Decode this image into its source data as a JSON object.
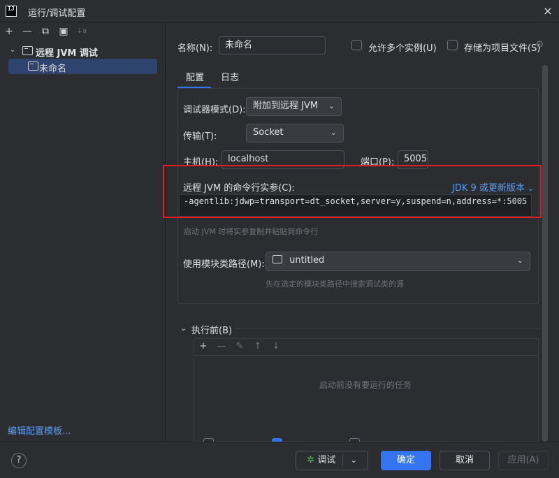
{
  "window": {
    "title": "运行/调试配置",
    "close_icon": "×"
  },
  "left_toolbar": {
    "add": "+",
    "remove": "—",
    "copy": "⧉",
    "folder": "▣",
    "sort": "↓a"
  },
  "tree": {
    "root_label": "远程 JVM 调试",
    "child_label": "未命名"
  },
  "edit_templates_link": "编辑配置模板...",
  "form": {
    "name_label": "名称(N):",
    "name_value": "未命名",
    "allow_multiple": "允许多个实例(U)",
    "store_as_project": "存储为项目文件(S)",
    "tabs": [
      "配置",
      "日志"
    ],
    "debugger_mode_label": "调试器模式(D):",
    "debugger_mode_value": "附加到远程 JVM",
    "transport_label": "传输(T):",
    "transport_value": "Socket",
    "host_label": "主机(H):",
    "host_value": "localhost",
    "port_label": "端口(P):",
    "port_value": "5005",
    "cmdline_label": "远程 JVM 的命令行实参(C):",
    "jdk_version": "JDK 9 或更新版本",
    "cmdline_value": "-agentlib:jdwp=transport=dt_socket,server=y,suspend=n,address=*:5005",
    "cmdline_hint": "启动 JVM 时将实参复制并粘贴到命令行",
    "module_label": "使用模块类路径(M):",
    "module_value": "untitled",
    "module_hint": "先在选定的模块类路径中搜索调试类的源",
    "before_launch_label": "执行前(B)",
    "before_launch_empty": "启动前没有要运行的任务"
  },
  "buttons": {
    "help": "?",
    "debug": "调试",
    "ok": "确定",
    "cancel": "取消",
    "apply": "应用(A)"
  },
  "colors": {
    "accent": "#3574f0",
    "highlight": "#e51c23",
    "link": "#589df6"
  }
}
